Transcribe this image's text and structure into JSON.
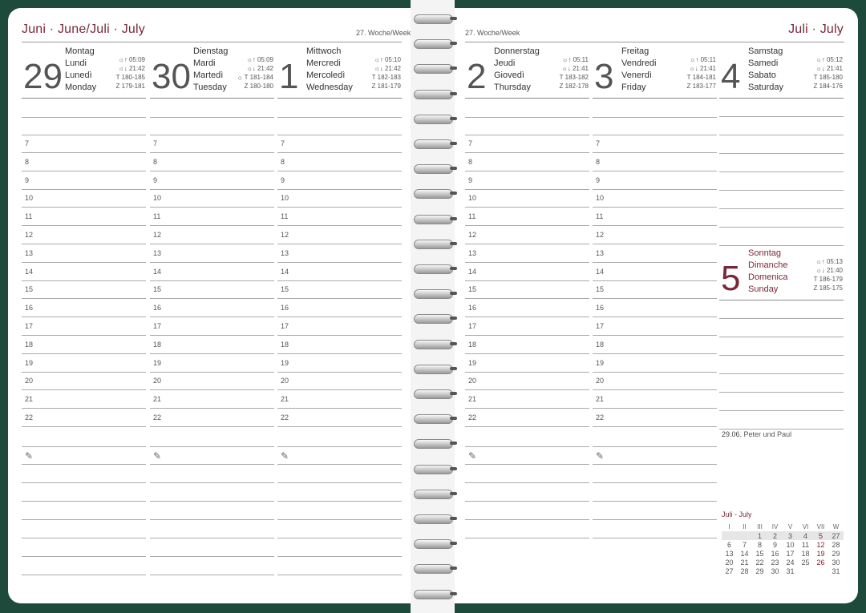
{
  "left_page": {
    "month_title": "Juni · June/Juli · July",
    "week_label": "27. Woche/Week",
    "days": [
      {
        "num": "29",
        "names": [
          "Montag",
          "Lundi",
          "Lunedì",
          "Monday"
        ],
        "sunrise": "05:09",
        "sunset": "21:42",
        "t": "T 180-185",
        "z": "Z 179-181"
      },
      {
        "num": "30",
        "names": [
          "Dienstag",
          "Mardi",
          "Martedì",
          "Tuesday"
        ],
        "sunrise": "05:09",
        "sunset": "21:42",
        "t": "T 181-184",
        "z": "Z 180-180"
      },
      {
        "num": "1",
        "names": [
          "Mittwoch",
          "Mercredi",
          "Mercoledì",
          "Wednesday"
        ],
        "sunrise": "05:10",
        "sunset": "21:42",
        "t": "T 182-183",
        "z": "Z 181-179"
      }
    ]
  },
  "right_page": {
    "month_title": "Juli · July",
    "week_label": "27. Woche/Week",
    "days": [
      {
        "num": "2",
        "names": [
          "Donnerstag",
          "Jeudi",
          "Giovedì",
          "Thursday"
        ],
        "sunrise": "05:11",
        "sunset": "21:41",
        "t": "T 183-182",
        "z": "Z 182-178"
      },
      {
        "num": "3",
        "names": [
          "Freitag",
          "Vendredi",
          "Venerdì",
          "Friday"
        ],
        "sunrise": "05:11",
        "sunset": "21:41",
        "t": "T 184-181",
        "z": "Z 183-177"
      },
      {
        "num": "4",
        "names": [
          "Samstag",
          "Samedi",
          "Sabato",
          "Saturday"
        ],
        "sunrise": "05:12",
        "sunset": "21:41",
        "t": "T 185-180",
        "z": "Z 184-176"
      },
      {
        "num": "5",
        "names": [
          "Sonntag",
          "Dimanche",
          "Domenica",
          "Sunday"
        ],
        "sunrise": "05:13",
        "sunset": "21:40",
        "t": "T 186-179",
        "z": "Z 185-175"
      }
    ],
    "holiday": {
      "date": "29.06.",
      "name": "Peter und Paul"
    }
  },
  "hours": [
    "7",
    "8",
    "9",
    "10",
    "11",
    "12",
    "13",
    "14",
    "15",
    "16",
    "17",
    "18",
    "19",
    "20",
    "21",
    "22"
  ],
  "icons": {
    "sunrise": "sunrise-icon",
    "sunset": "sunset-icon",
    "notes": "pencil-icon",
    "new_moon": "new-moon-icon"
  },
  "colors": {
    "accent": "#7a2838",
    "cover": "#1d4a3b"
  },
  "mini_calendar": {
    "title": "Juli - July",
    "headers": [
      "I",
      "II",
      "III",
      "IV",
      "V",
      "VI",
      "VII",
      "W"
    ],
    "rows": [
      [
        "",
        "",
        "1",
        "2",
        "3",
        "4",
        "5",
        "27"
      ],
      [
        "6",
        "7",
        "8",
        "9",
        "10",
        "11",
        "12",
        "28"
      ],
      [
        "13",
        "14",
        "15",
        "16",
        "17",
        "18",
        "19",
        "29"
      ],
      [
        "20",
        "21",
        "22",
        "23",
        "24",
        "25",
        "26",
        "30"
      ],
      [
        "27",
        "28",
        "29",
        "30",
        "31",
        "",
        "",
        "31"
      ]
    ]
  }
}
